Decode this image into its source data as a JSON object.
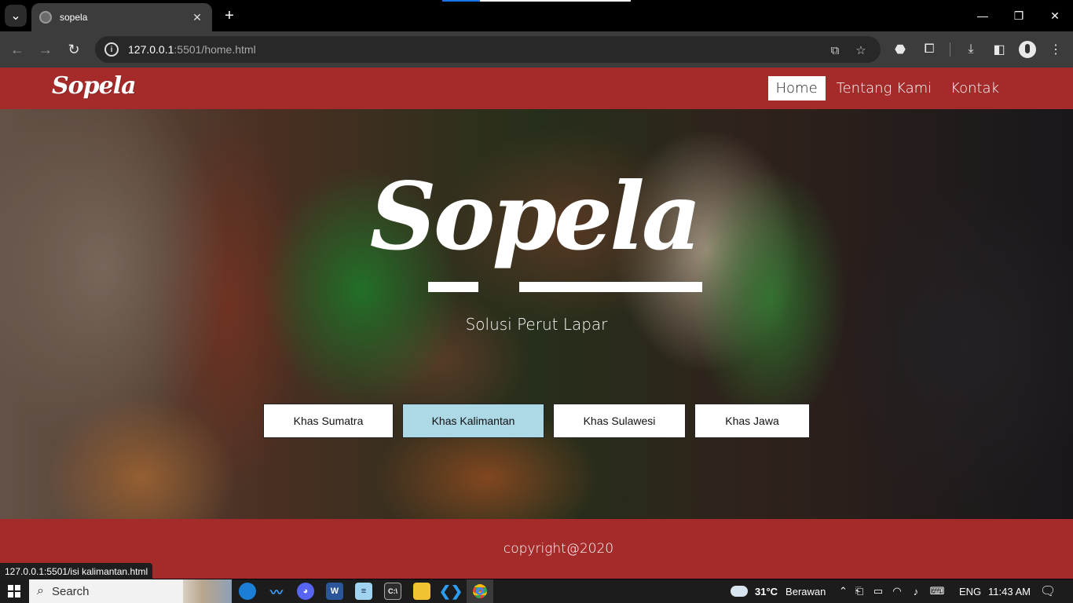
{
  "browser": {
    "tab_title": "sopela",
    "url_host": "127.0.0.1",
    "url_rest": ":5501/home.html",
    "status_url": "127.0.0.1:5501/isi kalimantan.html"
  },
  "site": {
    "logo": "Sopela",
    "nav": [
      {
        "label": "Home",
        "active": true
      },
      {
        "label": "Tentang Kami",
        "active": false
      },
      {
        "label": "Kontak",
        "active": false
      }
    ],
    "hero_title": "Sopela",
    "hero_subtitle": "Solusi Perut Lapar",
    "regions": [
      "Khas Sumatra",
      "Khas Kalimantan",
      "Khas Sulawesi",
      "Khas Jawa"
    ],
    "hovered_region": "Khas Kalimantan",
    "footer": "copyright@2020",
    "colors": {
      "brand": "#a52a2a",
      "hover": "#add8e6"
    }
  },
  "taskbar": {
    "search_label": "Search",
    "weather_temp": "31°C",
    "weather_desc": "Berawan",
    "language": "ENG",
    "time": "11:43 AM"
  }
}
